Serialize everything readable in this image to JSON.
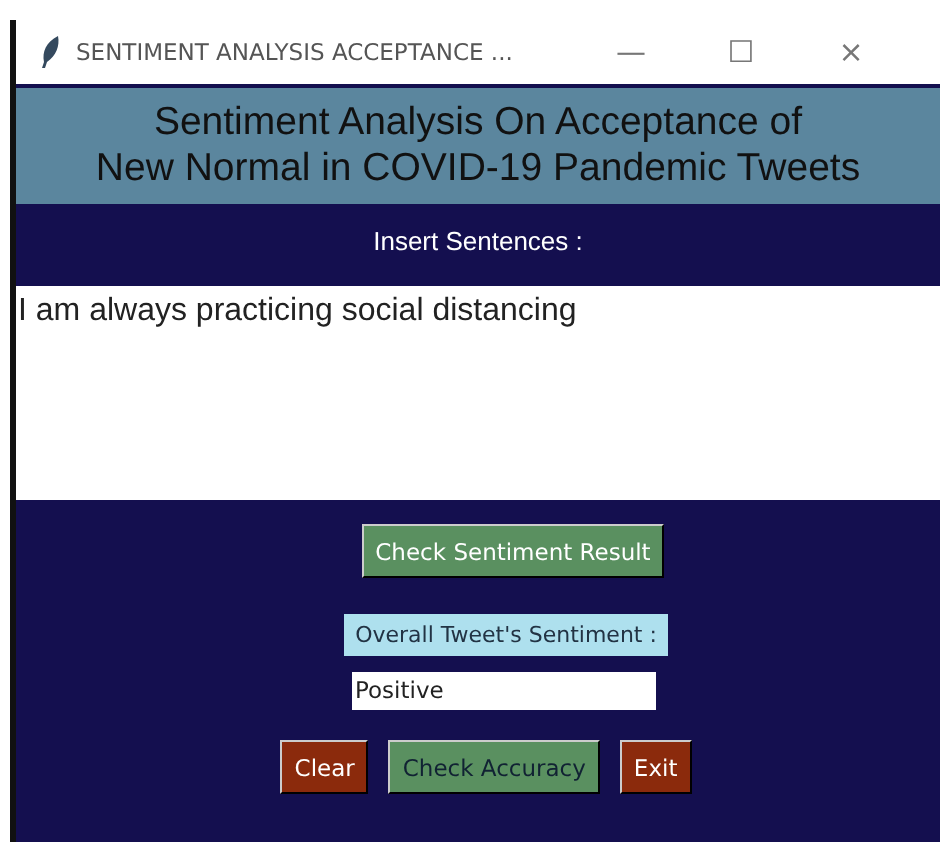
{
  "window": {
    "title": "SENTIMENT ANALYSIS ACCEPTANCE ...",
    "controls": [
      "—",
      "☐",
      "×"
    ]
  },
  "heading": [
    "Sentiment Analysis On Acceptance of",
    "New Normal in COVID-19 Pandemic Tweets"
  ],
  "input_label": "Insert Sentences :",
  "sentences": {
    "value": "I am always practicing social distancing"
  },
  "check_button": {
    "label": "Check Sentiment Result",
    "kind": "go"
  },
  "result_label": "Overall Tweet's Sentiment :",
  "result": {
    "value": "Positive"
  },
  "buttons": [
    {
      "label": "Clear",
      "kind": "stop"
    },
    {
      "label": "Check Accuracy",
      "kind": "check"
    },
    {
      "label": "Exit",
      "kind": "stop"
    }
  ]
}
